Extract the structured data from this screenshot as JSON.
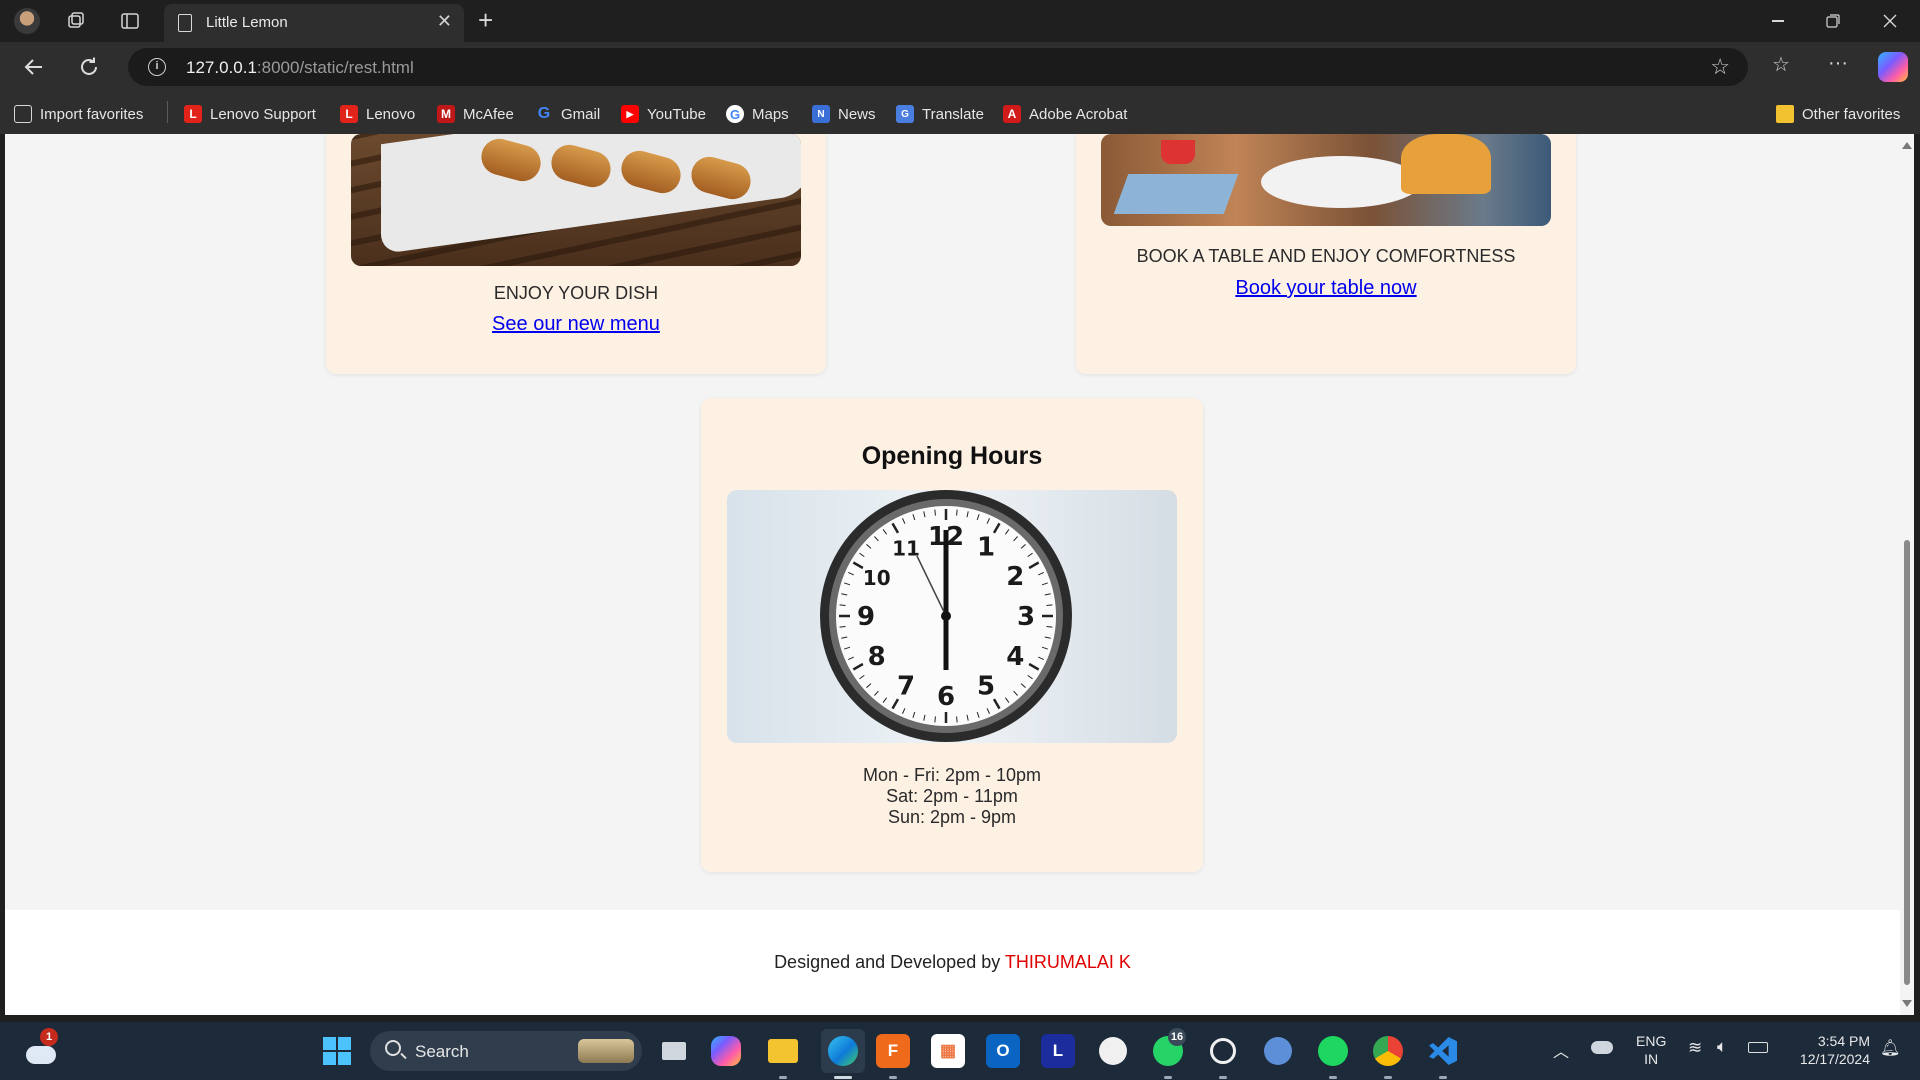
{
  "browser": {
    "tab_title": "Little Lemon",
    "url_host": "127.0.0.1",
    "url_rest": ":8000/static/rest.html",
    "new_tab_symbol": "+",
    "close_symbol": "✕",
    "menu_symbol": "···"
  },
  "favorites": [
    {
      "label": "Import favorites",
      "icon": "import-icon",
      "color": "#2e2e2e"
    },
    {
      "label": "Lenovo Support",
      "icon": "lenovo-icon",
      "color": "#e2231a"
    },
    {
      "label": "Lenovo",
      "icon": "lenovo-icon",
      "color": "#e2231a"
    },
    {
      "label": "McAfee",
      "icon": "mcafee-icon",
      "color": "#c01818"
    },
    {
      "label": "Gmail",
      "icon": "google-icon",
      "color": "#ffffff"
    },
    {
      "label": "YouTube",
      "icon": "youtube-icon",
      "color": "#ff0000"
    },
    {
      "label": "Maps",
      "icon": "google-icon",
      "color": "#ffffff"
    },
    {
      "label": "News",
      "icon": "news-icon",
      "color": "#3a6fd8"
    },
    {
      "label": "Translate",
      "icon": "translate-icon",
      "color": "#4a7ee0"
    },
    {
      "label": "Adobe Acrobat",
      "icon": "acrobat-icon",
      "color": "#d11b1b"
    }
  ],
  "other_favorites": "Other favorites",
  "page": {
    "dish_caption": "ENJOY YOUR DISH",
    "dish_link": "See our new menu",
    "table_caption": "BOOK A TABLE AND ENJOY COMFORTNESS",
    "table_link": "Book your table now",
    "opening_title": "Opening Hours",
    "hours": [
      "Mon - Fri: 2pm - 10pm",
      "Sat: 2pm - 11pm",
      "Sun: 2pm - 9pm"
    ],
    "footer_prefix": "Designed and Developed by ",
    "footer_name": "THIRUMALAI K"
  },
  "clock": {
    "numerals": [
      "12",
      "1",
      "2",
      "3",
      "4",
      "5",
      "6",
      "7",
      "8",
      "9",
      "10",
      "11"
    ]
  },
  "taskbar": {
    "search_label": "Search",
    "weather_badge": "1",
    "whatsapp_badge": "16",
    "lang_top": "ENG",
    "lang_bottom": "IN",
    "time": "3:54 PM",
    "date": "12/17/2024"
  }
}
